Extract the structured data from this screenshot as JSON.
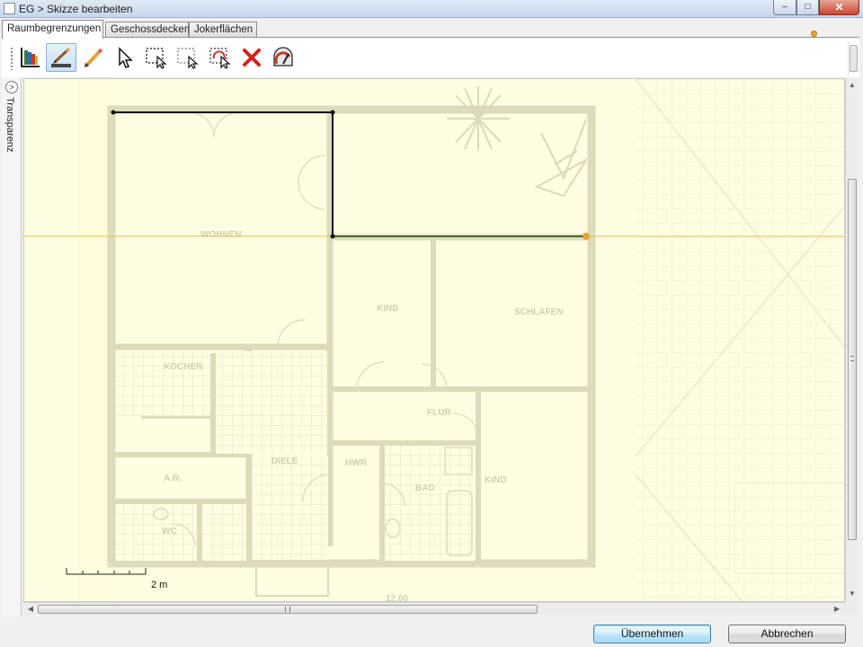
{
  "window": {
    "title": "EG > Skizze bearbeiten",
    "minimize": "–",
    "maximize": "□",
    "close": "✕"
  },
  "tabs": [
    {
      "label": "Raumbegrenzungen",
      "active": true
    },
    {
      "label": "Geschossdecken",
      "active": false
    },
    {
      "label": "Jokerflächen",
      "active": false
    }
  ],
  "toolbar": {
    "tools": [
      {
        "name": "layers-tool",
        "icon": "book-layers-icon",
        "selected": false
      },
      {
        "name": "draw-wall-tool",
        "icon": "pen-ruler-icon",
        "selected": true
      },
      {
        "name": "pencil-tool",
        "icon": "pencil-icon",
        "selected": false
      },
      {
        "name": "select-tool",
        "icon": "cursor-arrow-icon",
        "selected": false
      },
      {
        "name": "select-area-tool",
        "icon": "select-rectangle-icon",
        "selected": false
      },
      {
        "name": "select-dashed-tool",
        "icon": "select-dashed-icon",
        "selected": false
      },
      {
        "name": "select-rotate-tool",
        "icon": "select-rotate-icon",
        "selected": false
      },
      {
        "name": "delete-tool",
        "icon": "red-x-icon",
        "selected": false
      },
      {
        "name": "measure-tool",
        "icon": "gauge-icon",
        "selected": false
      }
    ]
  },
  "sidepanel": {
    "label": "Transparenz",
    "toggle": ">"
  },
  "floorplan": {
    "rooms": [
      "WOHNEN",
      "KIND",
      "SCHLAFEN",
      "KOCHEN",
      "FLUR",
      "A.R.",
      "DIELE",
      "HWR",
      "BAD",
      "KIND",
      "WC"
    ],
    "dimension": "12.00",
    "scale_label": "2 m",
    "guide_color": "#f0c040",
    "line_color": "#000000",
    "accent_color": "#f0a030"
  },
  "buttons": {
    "ok": "Übernehmen",
    "cancel": "Abbrechen"
  }
}
